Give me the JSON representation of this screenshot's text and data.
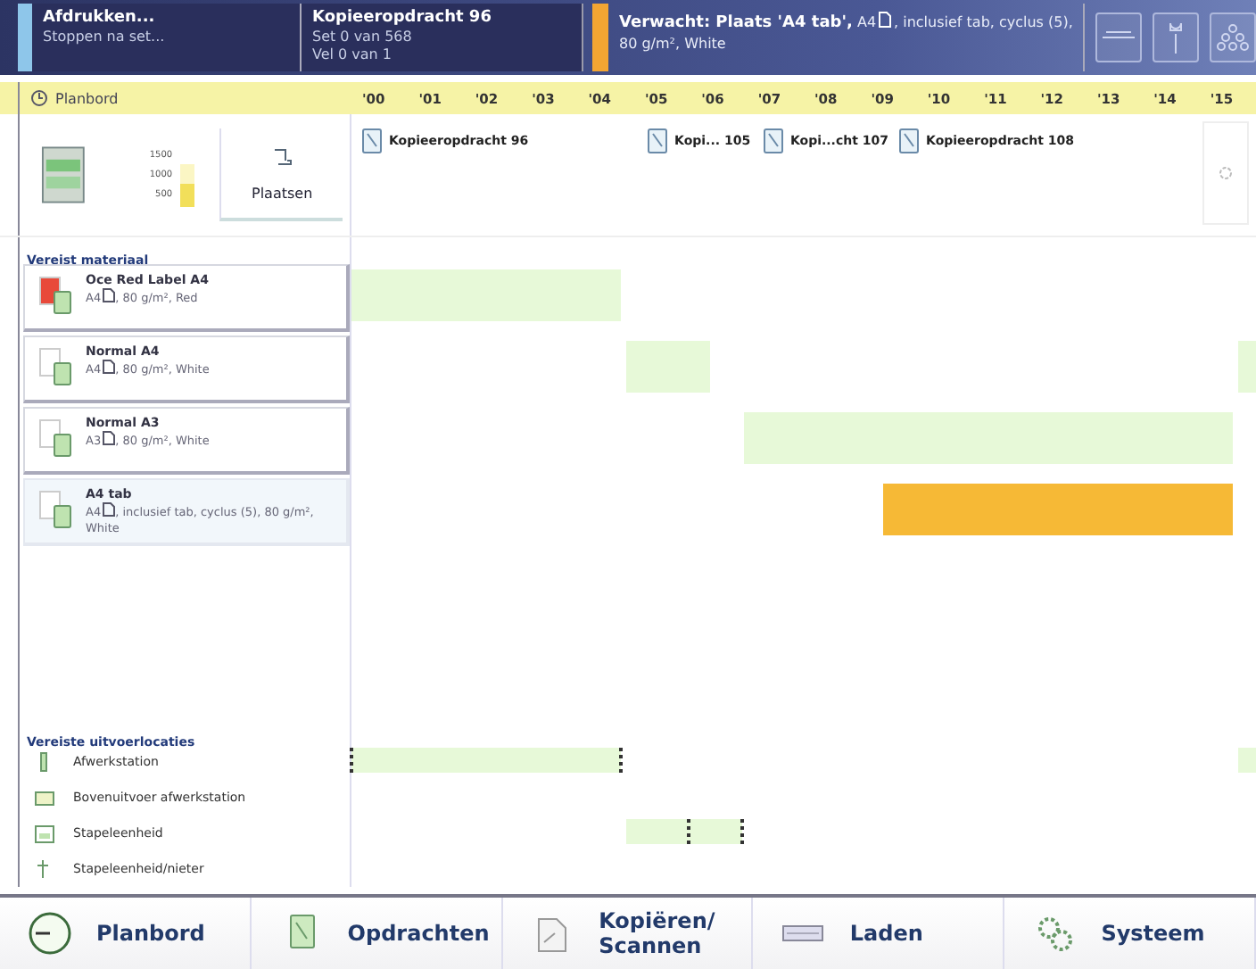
{
  "status": {
    "activity": "Afdrukken...",
    "activity_note": "Stoppen na set...",
    "job_title": "Kopieeropdracht 96",
    "job_lines": [
      "Set 0 van 568",
      "Vel 0 van 1"
    ],
    "message_bold": "Verwacht: Plaats 'A4 tab',",
    "message_size": "A4",
    "message_rest": ", inclusief tab, cyclus (5),",
    "message_line2": "80 g/m², White"
  },
  "planbord": {
    "title": "Planbord",
    "hours": [
      "'00",
      "'01",
      "'02",
      "'03",
      "'04",
      "'05",
      "'06",
      "'07",
      "'08",
      "'09",
      "'10",
      "'11",
      "'12",
      "'13",
      "'14",
      "'15"
    ]
  },
  "tray": {
    "levels": [
      "1500",
      "1000",
      "500"
    ],
    "level": 0.55,
    "button": "Plaatsen"
  },
  "jobs": [
    {
      "label": "Kopieeropdracht 96"
    },
    {
      "label": "Kopi... 105"
    },
    {
      "label": "Kopi...cht 107"
    },
    {
      "label": "Kopieeropdracht 108"
    }
  ],
  "materials_heading": "Vereist materiaal",
  "materials": [
    {
      "name": "Oce Red Label A4",
      "size": "A4",
      "detail": ", 80 g/m², Red",
      "color": "#e8493a",
      "selected": false,
      "bars": [
        {
          "kind": "planned"
        }
      ]
    },
    {
      "name": "Normal A4",
      "size": "A4",
      "detail": ", 80 g/m², White",
      "color": "#ffffff",
      "selected": false,
      "bars": [
        {
          "kind": "planned"
        },
        {
          "kind": "planned"
        }
      ]
    },
    {
      "name": "Normal A3",
      "size": "A3",
      "detail": ", 80 g/m², White",
      "color": "#ffffff",
      "selected": false,
      "bars": [
        {
          "kind": "planned"
        }
      ]
    },
    {
      "name": "A4 tab",
      "size": "A4",
      "detail": ", inclusief tab, cyclus (5), 80 g/m², White",
      "color": "#ffffff",
      "selected": true,
      "bars": [
        {
          "kind": "waiting"
        }
      ]
    }
  ],
  "locations_heading": "Vereiste uitvoerlocaties",
  "locations": [
    {
      "name": "Afwerkstation",
      "kind": "finisher",
      "bars": [
        {
          "kind": "planned"
        },
        {
          "kind": "planned"
        },
        {
          "kind": "marker"
        },
        {
          "kind": "marker"
        }
      ]
    },
    {
      "name": "Bovenuitvoer afwerkstation",
      "kind": "top-tray"
    },
    {
      "name": "Stapeleenheid",
      "kind": "stacker",
      "bars": [
        {
          "kind": "planned"
        },
        {
          "kind": "marker"
        },
        {
          "kind": "marker"
        }
      ]
    },
    {
      "name": "Stapeleenheid/nieter",
      "kind": "stapler"
    }
  ],
  "nav": [
    {
      "label": "Planbord",
      "kind": "clock"
    },
    {
      "label": "Opdrachten",
      "kind": "jobs"
    },
    {
      "label": "Kopiëren/ Scannen",
      "kind": "copy"
    },
    {
      "label": "Laden",
      "kind": "load"
    },
    {
      "label": "Systeem",
      "kind": "system"
    }
  ]
}
